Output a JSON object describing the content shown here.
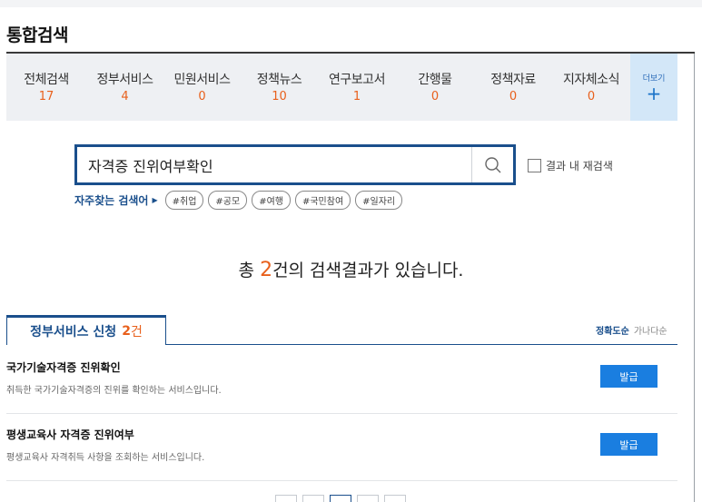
{
  "page": {
    "title": "통합검색"
  },
  "categories": [
    {
      "label": "전체검색",
      "count": "17"
    },
    {
      "label": "정부서비스",
      "count": "4"
    },
    {
      "label": "민원서비스",
      "count": "0"
    },
    {
      "label": "정책뉴스",
      "count": "10"
    },
    {
      "label": "연구보고서",
      "count": "1"
    },
    {
      "label": "간행물",
      "count": "0"
    },
    {
      "label": "정책자료",
      "count": "0"
    },
    {
      "label": "지자체소식",
      "count": "0"
    }
  ],
  "more": {
    "label": "더보기",
    "icon": "plus-icon",
    "symbol": "+"
  },
  "search": {
    "value": "자격증 진위여부확인",
    "button_icon": "search-icon"
  },
  "research": {
    "label": "결과 내 재검색",
    "checked": false
  },
  "frequent": {
    "label": "자주찾는 검색어",
    "tags": [
      "#취업",
      "#공모",
      "#여행",
      "#국민참여",
      "#일자리"
    ]
  },
  "summary": {
    "prefix": "총 ",
    "count": "2",
    "suffix": "건의 검색결과가 있습니다."
  },
  "section": {
    "label": "정부서비스 신청",
    "count": "2",
    "unit": "건"
  },
  "sort": {
    "active": "정확도순",
    "inactive": "가나다순"
  },
  "results": [
    {
      "title": "국가기술자격증 진위확인",
      "desc": "취득한 국가기술자격증의 진위를 확인하는 서비스입니다.",
      "button": "발급"
    },
    {
      "title": "평생교육사 자격증 진위여부",
      "desc": "평생교육사 자격취득 사항을 조회하는 서비스입니다.",
      "button": "발급"
    }
  ],
  "colors": {
    "accent": "#1a4f8c",
    "count": "#e8601c",
    "button": "#1a7ee0"
  }
}
